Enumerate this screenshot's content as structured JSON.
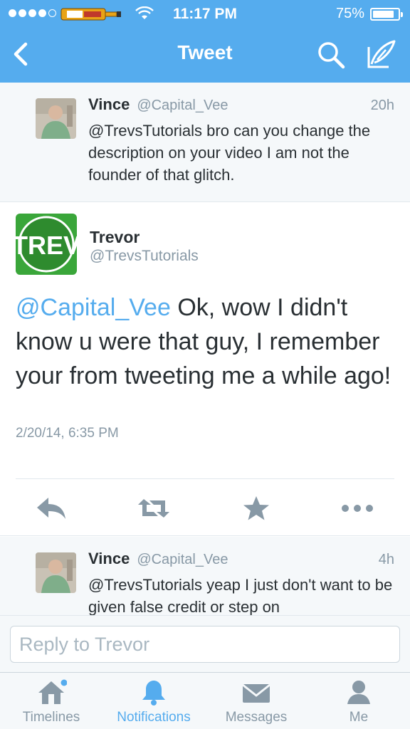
{
  "status_bar": {
    "time": "11:17 PM",
    "battery_percent": "75%",
    "signal_bars_filled": 4,
    "battery_level": 0.75
  },
  "nav": {
    "title": "Tweet",
    "back_icon": "chevron-left-icon",
    "search_icon": "search-icon",
    "compose_icon": "compose-icon"
  },
  "tweets": {
    "reply_top": {
      "name": "Vince",
      "handle": "@Capital_Vee",
      "time": "20h",
      "text": "@TrevsTutorials bro can you change the description on your video I am not the founder of that glitch."
    },
    "main": {
      "name": "Trevor",
      "handle": "@TrevsTutorials",
      "mention": "@Capital_Vee",
      "text": " Ok, wow I didn't know u were that guy, I remember your from tweeting me a while ago!",
      "date": "2/20/14, 6:35 PM",
      "avatar_text": "TREV"
    },
    "reply_bottom": {
      "name": "Vince",
      "handle": "@Capital_Vee",
      "time": "4h",
      "text": "@TrevsTutorials yeap I just don't want to be given false credit or step on"
    }
  },
  "actions": [
    "reply-icon",
    "retweet-icon",
    "favorite-icon",
    "more-icon"
  ],
  "reply_box": {
    "placeholder": "Reply to Trevor"
  },
  "tabs": [
    {
      "label": "Timelines",
      "icon": "home-icon"
    },
    {
      "label": "Notifications",
      "icon": "bell-icon"
    },
    {
      "label": "Messages",
      "icon": "envelope-icon"
    },
    {
      "label": "Me",
      "icon": "person-icon"
    }
  ],
  "colors": {
    "brand": "#55acee",
    "text": "#292f33",
    "secondary": "#8899a6"
  }
}
